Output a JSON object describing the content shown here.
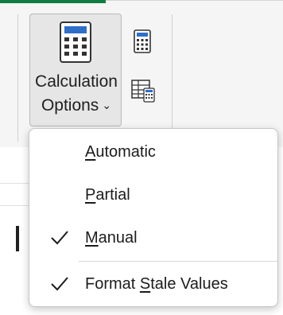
{
  "ribbon": {
    "calculation_options": {
      "line1": "Calculation",
      "line2": "Options",
      "icon": "calculator-icon",
      "chevron": "chevron-down-icon"
    },
    "calculate_now": {
      "icon": "calculator-small-icon"
    },
    "calculate_sheet": {
      "icon": "sheet-calculator-icon"
    }
  },
  "menu": {
    "items": [
      {
        "before": "",
        "accel": "A",
        "after": "utomatic",
        "checked": false
      },
      {
        "before": "",
        "accel": "P",
        "after": "artial",
        "checked": false
      },
      {
        "before": "",
        "accel": "M",
        "after": "anual",
        "checked": true
      },
      {
        "before": "Format ",
        "accel": "S",
        "after": "tale Values",
        "checked": true
      }
    ]
  },
  "colors": {
    "accent_green": "#107c41",
    "calculator_blue": "#2f6fc9",
    "ribbon_bg": "#f5f5f5",
    "pressed_button_bg": "#e6e6e6"
  }
}
